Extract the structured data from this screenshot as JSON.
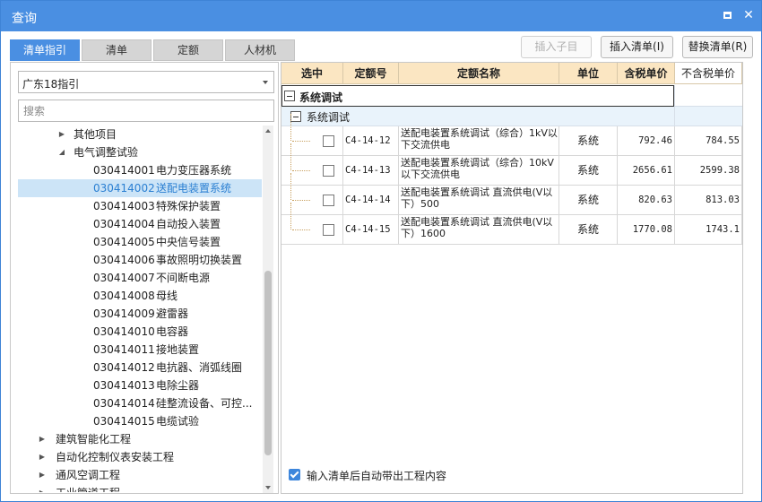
{
  "window": {
    "title": "查询"
  },
  "tabs": [
    "清单指引",
    "清单",
    "定额",
    "人材机"
  ],
  "buttons": {
    "insert_child": "插入子目",
    "insert_list": "插入清单(I)",
    "replace_list": "替换清单(R)"
  },
  "left": {
    "select_value": "广东18指引",
    "search_placeholder": "搜索",
    "tree": [
      {
        "label": "其他项目",
        "arrow": "▶"
      },
      {
        "label": "电气调整试验",
        "arrow": "◢"
      },
      {
        "code": "030414001",
        "name": "电力变压器系统"
      },
      {
        "code": "030414002",
        "name": "送配电装置系统"
      },
      {
        "code": "030414003",
        "name": "特殊保护装置"
      },
      {
        "code": "030414004",
        "name": "自动投入装置"
      },
      {
        "code": "030414005",
        "name": "中央信号装置"
      },
      {
        "code": "030414006",
        "name": "事故照明切换装置"
      },
      {
        "code": "030414007",
        "name": "不间断电源"
      },
      {
        "code": "030414008",
        "name": "母线"
      },
      {
        "code": "030414009",
        "name": "避雷器"
      },
      {
        "code": "030414010",
        "name": "电容器"
      },
      {
        "code": "030414011",
        "name": "接地装置"
      },
      {
        "code": "030414012",
        "name": "电抗器、消弧线圈"
      },
      {
        "code": "030414013",
        "name": "电除尘器"
      },
      {
        "code": "030414014",
        "name": "硅整流设备、可控..."
      },
      {
        "code": "030414015",
        "name": "电缆试验"
      },
      {
        "label": "建筑智能化工程",
        "arrow": "▶"
      },
      {
        "label": "自动化控制仪表安装工程",
        "arrow": "▶"
      },
      {
        "label": "通风空调工程",
        "arrow": "▶"
      },
      {
        "label": "工业管道工程",
        "arrow": "▶"
      }
    ]
  },
  "grid": {
    "headers": [
      "选中",
      "定额号",
      "定额名称",
      "单位",
      "含税单价",
      "不含税单价"
    ],
    "group1": "系统调试",
    "group2": "系统调试",
    "rows": [
      {
        "code": "C4-14-12",
        "name": "送配电装置系统调试（综合）1kV以下交流供电",
        "unit": "系统",
        "price_tax": "792.46",
        "price_notax": "784.55"
      },
      {
        "code": "C4-14-13",
        "name": "送配电装置系统调试（综合）10kV以下交流供电",
        "unit": "系统",
        "price_tax": "2656.61",
        "price_notax": "2599.38"
      },
      {
        "code": "C4-14-14",
        "name": "送配电装置系统调试 直流供电(V以下）500",
        "unit": "系统",
        "price_tax": "820.63",
        "price_notax": "813.03"
      },
      {
        "code": "C4-14-15",
        "name": "送配电装置系统调试 直流供电(V以下）1600",
        "unit": "系统",
        "price_tax": "1770.08",
        "price_notax": "1743.1"
      }
    ]
  },
  "auto_check_label": "输入清单后自动带出工程内容"
}
